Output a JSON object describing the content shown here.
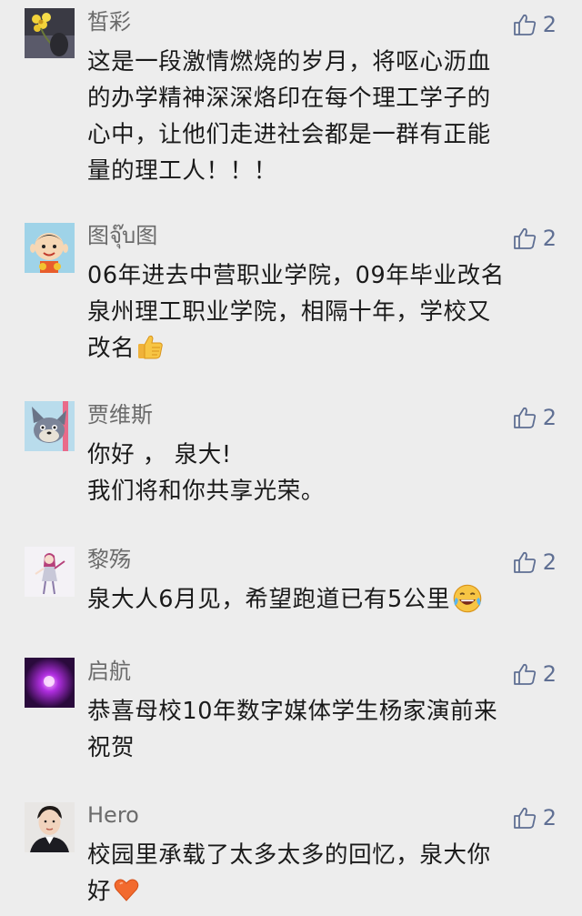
{
  "comments": [
    {
      "nickname": "皙彩",
      "likes": "2",
      "avatar_icon": "flower-portrait-avatar",
      "lines": [
        "这是一段激情燃烧的岁月，将呕心沥血",
        "的办学精神深深烙印在每个理工学子的",
        "心中，让他们走进社会都是一群有正能",
        "量的理工人！！！"
      ]
    },
    {
      "nickname": "图จุ๊บ图",
      "likes": "2",
      "avatar_icon": "cartoon-boy-avatar",
      "lines": [
        "06年进去中营职业学院，09年毕业改名",
        "泉州理工职业学院，相隔十年，学校又",
        "改名"
      ],
      "trailing_emoji": "thumbs-up-emoji"
    },
    {
      "nickname": "贾维斯",
      "likes": "2",
      "avatar_icon": "cartoon-cat-avatar",
      "lines": [
        "你好 ， 泉大!",
        "我们将和你共享光荣。"
      ]
    },
    {
      "nickname": "黎殇",
      "likes": "2",
      "avatar_icon": "anime-girl-avatar",
      "lines": [
        "泉大人6月见，希望跑道已有5公里"
      ],
      "trailing_emoji": "laughing-tears-emoji"
    },
    {
      "nickname": "启航",
      "likes": "2",
      "avatar_icon": "purple-glow-avatar",
      "lines": [
        "恭喜母校10年数字媒体学生杨家演前来",
        "祝贺"
      ]
    },
    {
      "nickname": "Hero",
      "likes": "2",
      "avatar_icon": "young-man-portrait-avatar",
      "lines": [
        "校园里承载了太多太多的回忆，泉大你",
        "好"
      ],
      "trailing_emoji": "orange-heart-emoji"
    }
  ],
  "colors": {
    "background": "#ededed",
    "nickname": "#6b6b6b",
    "text": "#1a1a1a",
    "like": "#5f6f93"
  }
}
